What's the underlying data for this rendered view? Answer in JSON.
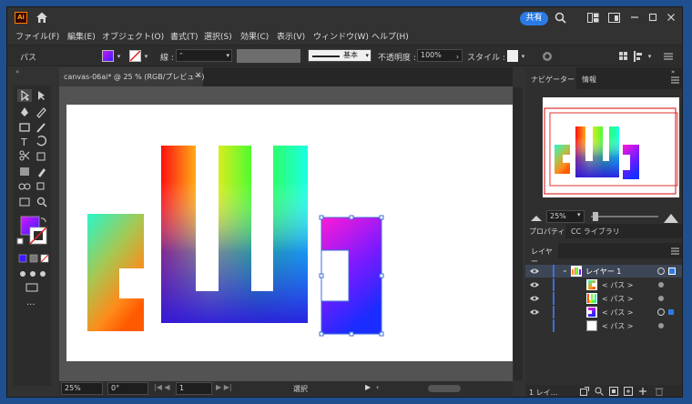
{
  "app": {
    "logo": "Ai",
    "share_label": "共有"
  },
  "menu": [
    "ファイル(F)",
    "編集(E)",
    "オブジェクト(O)",
    "書式(T)",
    "選択(S)",
    "効果(C)",
    "表示(V)",
    "ウィンドウ(W)",
    "ヘルプ(H)"
  ],
  "control": {
    "selection_label": "パス",
    "stroke_label": "線 :",
    "stroke_style": "基本",
    "opacity_label": "不透明度 :",
    "opacity_value": "100%",
    "style_label": "スタイル :"
  },
  "document_tab": {
    "title": "canvas-06ai* @ 25 % (RGB/プレビュー)",
    "close": "×"
  },
  "status": {
    "zoom": "25%",
    "rotation": "0°",
    "artboard": "1",
    "tool": "選択"
  },
  "navigator": {
    "tab1": "ナビゲーター",
    "tab2": "情報",
    "zoom": "25%"
  },
  "properties": {
    "tab1": "プロパティ",
    "tab2": "CC ライブラリ"
  },
  "layers": {
    "tab": "レイヤー",
    "layer_name": "レイヤー 1",
    "items": [
      "< パス >",
      "< パス >",
      "< パス >",
      "< パス >"
    ],
    "footer": "1 レイ…"
  },
  "colors": {
    "accent": "#2c7be5",
    "layer_blue": "#3d6fd9"
  }
}
